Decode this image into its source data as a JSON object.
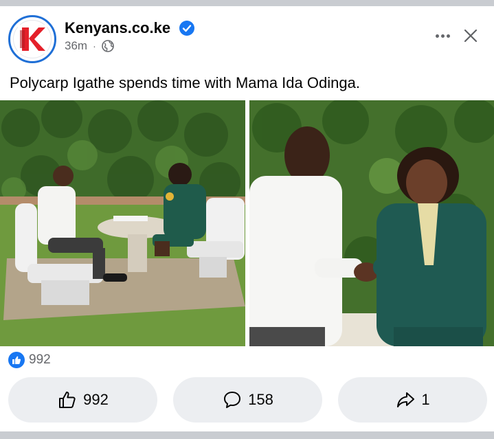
{
  "post": {
    "page_name": "Kenyans.co.ke",
    "time": "36m",
    "separator": "·",
    "text": "Polycarp Igathe spends time with Mama Ida Odinga.",
    "brand_color": "#e4202a",
    "verified_color": "#1877f2"
  },
  "summary": {
    "reaction_icon": "like-icon",
    "count": "992"
  },
  "actions": {
    "like": {
      "icon": "thumbs-up-icon",
      "count": "992"
    },
    "comment": {
      "icon": "comment-bubble-icon",
      "count": "158"
    },
    "share": {
      "icon": "share-arrow-icon",
      "count": "1"
    }
  }
}
